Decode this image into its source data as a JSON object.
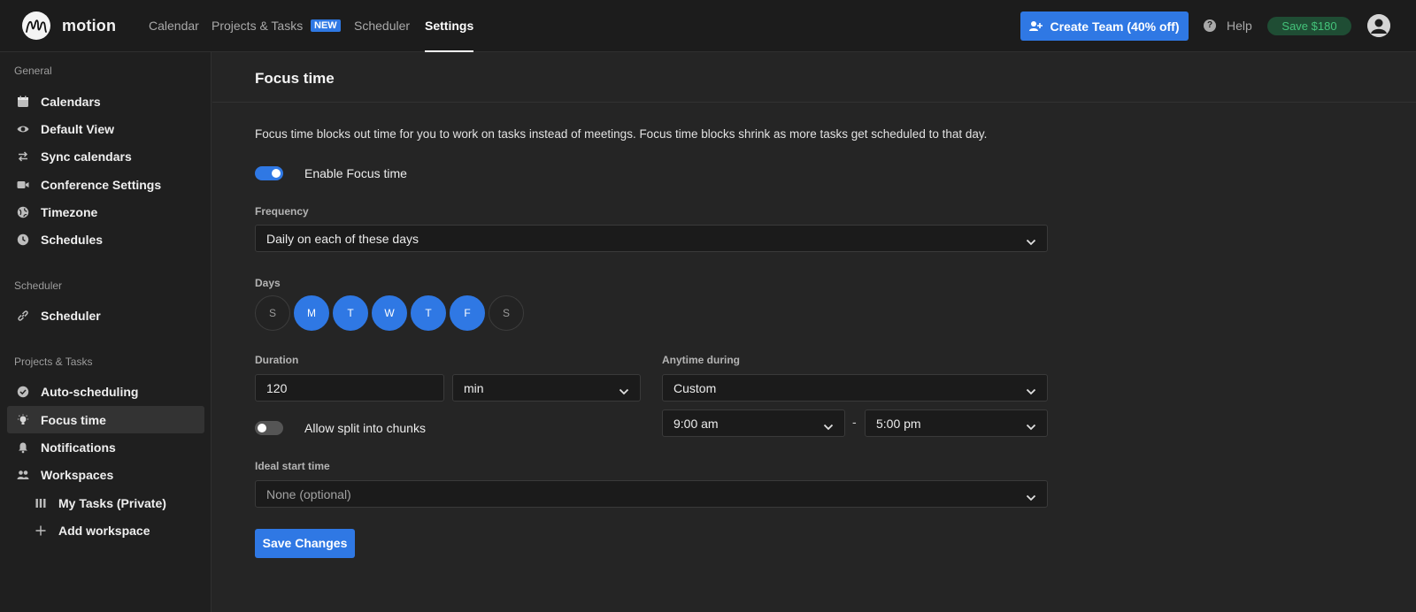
{
  "app": {
    "brand": "motion"
  },
  "nav": {
    "calendar": "Calendar",
    "projects_tasks": "Projects & Tasks",
    "new_badge": "NEW",
    "scheduler": "Scheduler",
    "settings": "Settings",
    "active": "Settings"
  },
  "header": {
    "create_team": "Create Team (40% off)",
    "help": "Help",
    "save_offer": "Save $180"
  },
  "sidebar": {
    "sections": [
      {
        "title": "General",
        "items": [
          {
            "label": "Calendars",
            "icon": "calendar-icon"
          },
          {
            "label": "Default View",
            "icon": "eye-icon"
          },
          {
            "label": "Sync calendars",
            "icon": "sync-arrows-icon"
          },
          {
            "label": "Conference Settings",
            "icon": "video-camera-icon"
          },
          {
            "label": "Timezone",
            "icon": "globe-icon"
          },
          {
            "label": "Schedules",
            "icon": "clock-icon"
          }
        ]
      },
      {
        "title": "Scheduler",
        "items": [
          {
            "label": "Scheduler",
            "icon": "link-icon"
          }
        ]
      },
      {
        "title": "Projects & Tasks",
        "items": [
          {
            "label": "Auto-scheduling",
            "icon": "check-circle-icon"
          },
          {
            "label": "Focus time",
            "icon": "lightbulb-icon",
            "active": true
          },
          {
            "label": "Notifications",
            "icon": "bell-icon"
          },
          {
            "label": "Workspaces",
            "icon": "users-icon"
          },
          {
            "label": "My Tasks (Private)",
            "icon": "columns-icon",
            "sub": true
          },
          {
            "label": "Add workspace",
            "icon": "plus-icon",
            "sub": true
          }
        ]
      }
    ]
  },
  "main": {
    "title": "Focus time",
    "description": "Focus time blocks out time for you to work on tasks instead of meetings. Focus time blocks shrink as more tasks get scheduled to that day.",
    "enable_toggle": {
      "label": "Enable Focus time",
      "on": true
    },
    "frequency": {
      "label": "Frequency",
      "value": "Daily on each of these days"
    },
    "days": {
      "label": "Days",
      "items": [
        {
          "letter": "S",
          "on": false
        },
        {
          "letter": "M",
          "on": true
        },
        {
          "letter": "T",
          "on": true
        },
        {
          "letter": "W",
          "on": true
        },
        {
          "letter": "T",
          "on": true
        },
        {
          "letter": "F",
          "on": true
        },
        {
          "letter": "S",
          "on": false
        }
      ]
    },
    "duration": {
      "label": "Duration",
      "value": "120",
      "unit": "min"
    },
    "split_toggle": {
      "label": "Allow split into chunks",
      "on": false
    },
    "anytime": {
      "label": "Anytime during",
      "value": "Custom",
      "start": "9:00 am",
      "separator": "-",
      "end": "5:00 pm"
    },
    "ideal_start": {
      "label": "Ideal start time",
      "placeholder": "None (optional)"
    },
    "save_button": "Save Changes"
  },
  "colors": {
    "accent": "#2f78e4",
    "page_bg": "#252525",
    "topbar_bg": "#1c1c1c",
    "sidebar_bg": "#1f1f1f",
    "save_pill_bg": "#1f4d34",
    "save_pill_text": "#44c37a"
  }
}
